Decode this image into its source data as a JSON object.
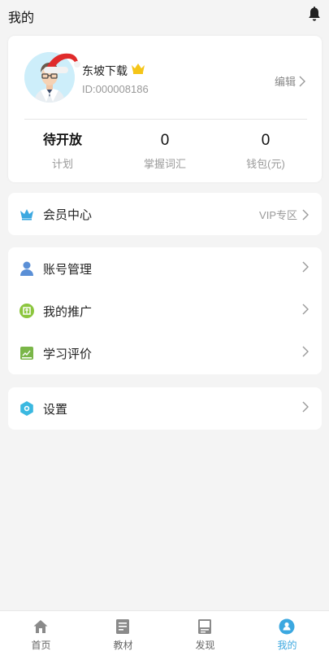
{
  "header": {
    "title": "我的",
    "bell_icon": "bell-icon"
  },
  "profile": {
    "avatar_icon": "avatar-icon",
    "decoration_icon": "santa-hat-icon",
    "username": "东坡下载",
    "vip_badge_icon": "crown-icon",
    "user_id": "ID:000008186",
    "edit_label": "编辑",
    "stats": [
      {
        "value": "待开放",
        "label": "计划"
      },
      {
        "value": "0",
        "label": "掌握词汇"
      },
      {
        "value": "0",
        "label": "钱包(元)"
      }
    ]
  },
  "menu": {
    "vip": {
      "icon": "crown-icon",
      "label": "会员中心",
      "right_text": "VIP专区"
    },
    "account": {
      "icon": "user-icon",
      "label": "账号管理"
    },
    "promotion": {
      "icon": "promotion-icon",
      "label": "我的推广"
    },
    "review": {
      "icon": "book-icon",
      "label": "学习评价"
    },
    "settings": {
      "icon": "gear-icon",
      "label": "设置"
    }
  },
  "tabbar": {
    "tabs": [
      {
        "icon": "home-icon",
        "label": "首页"
      },
      {
        "icon": "textbook-icon",
        "label": "教材"
      },
      {
        "icon": "discover-icon",
        "label": "发现"
      },
      {
        "icon": "profile-icon",
        "label": "我的"
      }
    ],
    "active_index": 3
  },
  "colors": {
    "accent": "#3ca8e0",
    "background": "#f4f4f4",
    "crown": "#f5c518"
  }
}
